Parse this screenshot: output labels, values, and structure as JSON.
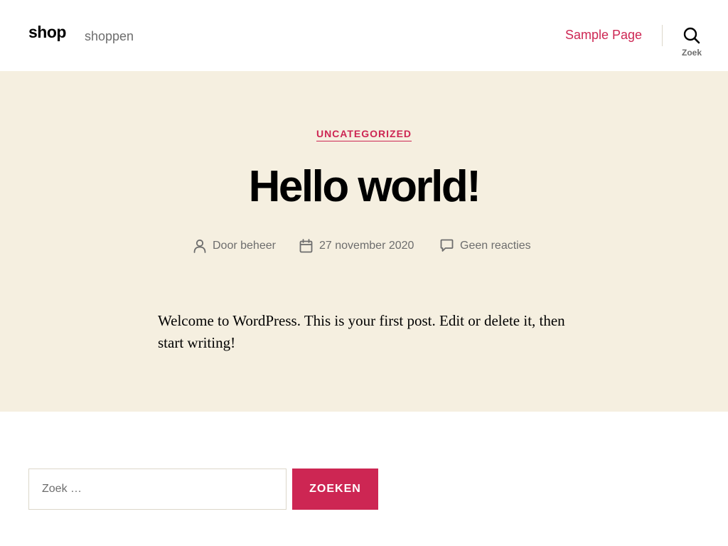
{
  "header": {
    "site_title": "shop",
    "site_description": "shoppen",
    "nav": [
      {
        "label": "Sample Page"
      }
    ],
    "search_toggle_label": "Zoek",
    "search_icon": "search-icon"
  },
  "post": {
    "category": "UNCATEGORIZED",
    "title": "Hello world!",
    "meta": {
      "author_text": "Door beheer",
      "author_icon": "person-icon",
      "date_text": "27 november 2020",
      "date_icon": "calendar-icon",
      "comments_text": "Geen reacties",
      "comments_icon": "comment-icon"
    },
    "content": "Welcome to WordPress. This is your first post. Edit or delete it, then start writing!"
  },
  "search_form": {
    "placeholder": "Zoek …",
    "value": "",
    "submit_label": "ZOEKEN"
  },
  "colors": {
    "accent": "#cd2653",
    "hero_background": "#f5efe0",
    "secondary_text": "#6d6d6d",
    "border": "#dcd7ca"
  }
}
